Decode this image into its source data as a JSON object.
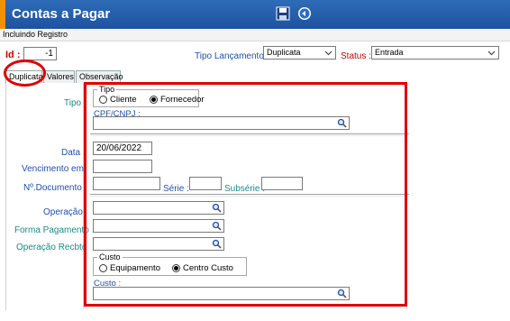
{
  "window": {
    "title": "Contas a Pagar"
  },
  "toolbar": {
    "save_icon": "save-icon",
    "back_icon": "refresh-icon"
  },
  "mode_tab": "Incluindo Registro",
  "header": {
    "id_label": "Id :",
    "id_value": "-1",
    "tipo_lancamento_label": "Tipo Lançamento :",
    "tipo_lancamento_value": "Duplicata",
    "status_label": "Status :",
    "status_value": "Entrada"
  },
  "tabs": [
    "Duplicata",
    "Valores",
    "Observação"
  ],
  "form": {
    "tipo_label": "Tipo",
    "tipo_group_title": "Tipo",
    "tipo_options": [
      "Cliente",
      "Fornecedor"
    ],
    "tipo_selected": "Fornecedor",
    "cpf_label": "CPF/CNPJ :",
    "cpf_value": "",
    "data_label": "Data",
    "data_value": "20/06/2022",
    "vencimento_label": "Vencimento em",
    "vencimento_value": "",
    "documento_label": "Nº.Documento",
    "documento_value": "",
    "serie_label": "Série :",
    "serie_value": "",
    "subserie_label": "Subsérie :",
    "subserie_value": "",
    "operacao_label": "Operação",
    "forma_pagamento_label": "Forma Pagamento",
    "operacao_recbto_label": "Operação Recbto",
    "custo_group_title": "Custo",
    "custo_options": [
      "Equipamento",
      "Centro Custo"
    ],
    "custo_selected": "Centro Custo",
    "custo_label": "Custo :",
    "custo_value": ""
  },
  "colors": {
    "title_bar": "#2f6cb8",
    "accent": "#f29100",
    "highlight": "#e00000",
    "label_blue": "#1f4fb0"
  }
}
